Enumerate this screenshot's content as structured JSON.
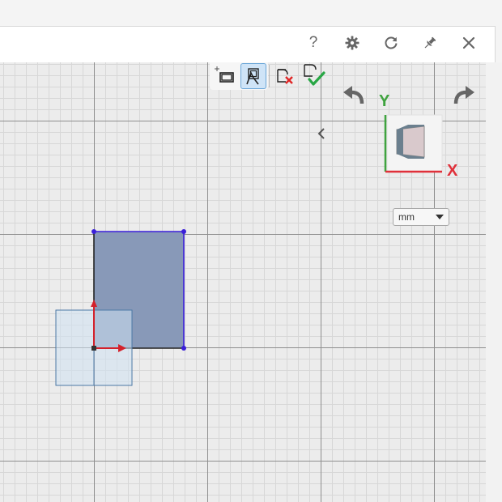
{
  "header": {
    "help_label": "?",
    "buttons": [
      "help",
      "settings",
      "refresh",
      "pin",
      "close"
    ]
  },
  "toolbar": {
    "tools": [
      {
        "name": "select-box-icon",
        "active": false
      },
      {
        "name": "select-lasso-icon",
        "active": true
      },
      {
        "name": "cancel-icon",
        "active": false
      },
      {
        "name": "confirm-icon",
        "active": false
      }
    ]
  },
  "view_cube": {
    "y_label": "Y",
    "x_label": "X",
    "y_color": "#3fa33f",
    "x_color": "#e0303a"
  },
  "units": {
    "selected": "mm"
  },
  "sketch": {
    "rect_fill": "#8899b8",
    "edge_color": "#3a1fd9",
    "origin_color": "#d4202a"
  }
}
